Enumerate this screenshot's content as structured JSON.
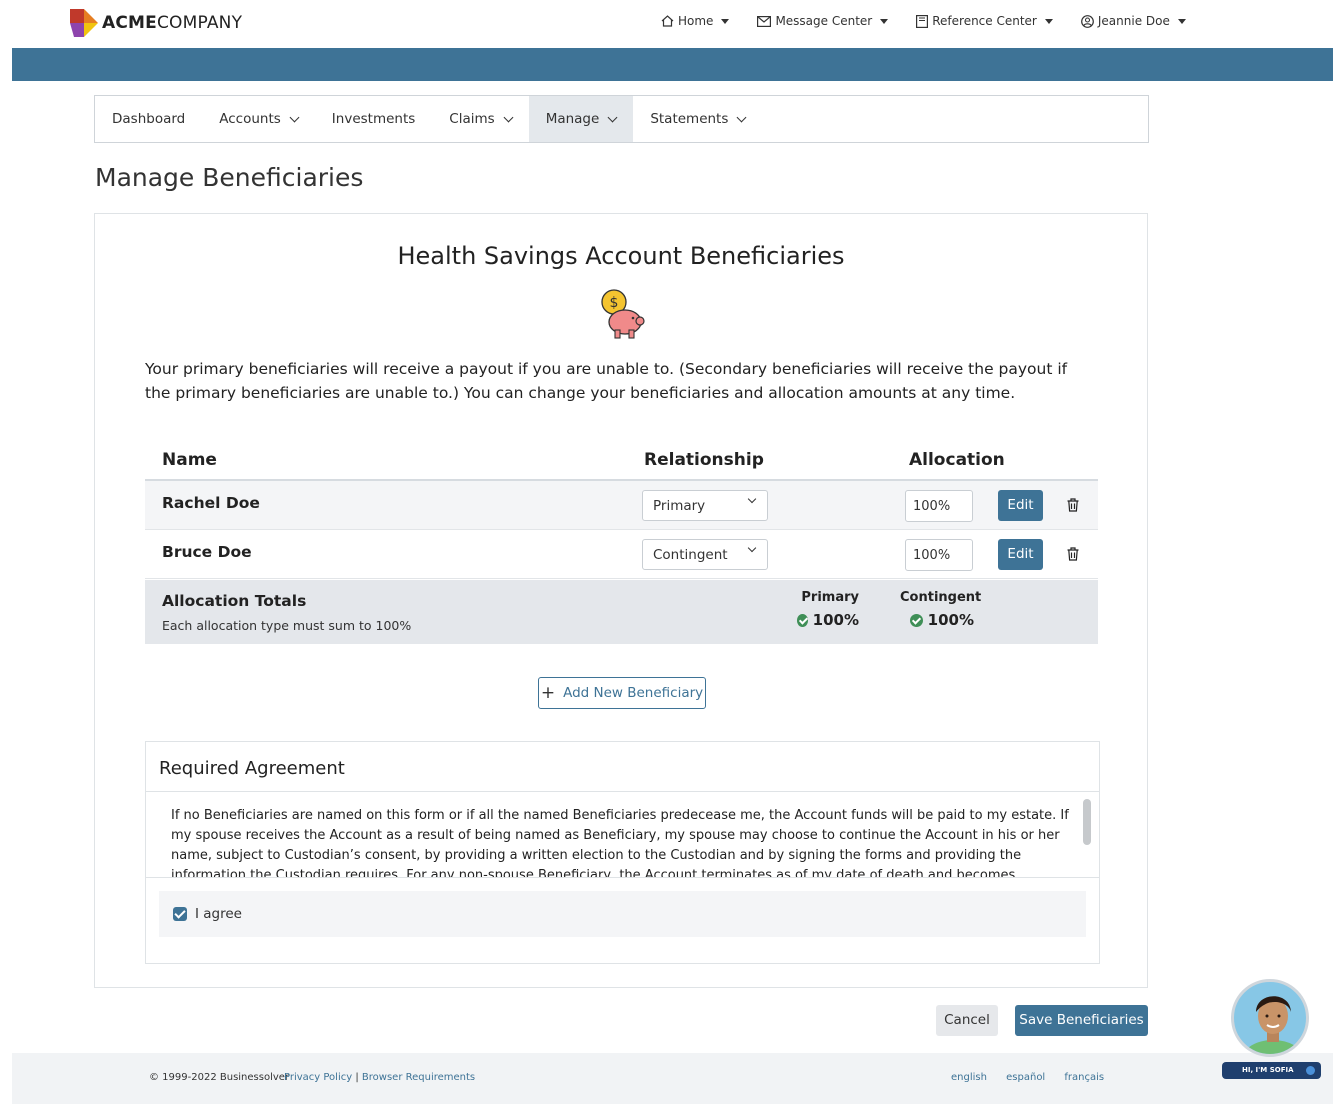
{
  "brand": {
    "bold": "ACME",
    "light": "COMPANY"
  },
  "topnav": {
    "home": "Home",
    "message_center": "Message Center",
    "reference_center": "Reference Center",
    "user": "Jeannie Doe"
  },
  "subnav": [
    {
      "label": "Dashboard"
    },
    {
      "label": "Accounts"
    },
    {
      "label": "Investments"
    },
    {
      "label": "Claims"
    },
    {
      "label": "Manage"
    },
    {
      "label": "Statements"
    }
  ],
  "page_title": "Manage Beneficiaries",
  "card": {
    "title": "Health Savings Account Beneficiaries",
    "intro": "Your primary beneficiaries will receive a payout if you are unable to. (Secondary beneficiaries will receive the payout if the primary beneficiaries are unable to.) You can change your beneficiaries and allocation amounts at any time."
  },
  "table": {
    "headers": {
      "name": "Name",
      "relationship": "Relationship",
      "allocation": "Allocation"
    },
    "rows": [
      {
        "name": "Rachel Doe",
        "relationship": "Primary",
        "allocation": "100%",
        "edit": "Edit"
      },
      {
        "name": "Bruce Doe",
        "relationship": "Contingent",
        "allocation": "100%",
        "edit": "Edit"
      }
    ]
  },
  "totals": {
    "title": "Allocation Totals",
    "subtitle": "Each allocation type must sum to 100%",
    "primary_label": "Primary",
    "primary_value": "100%",
    "contingent_label": "Contingent",
    "contingent_value": "100%"
  },
  "add_button": "Add New Beneficiary",
  "agreement": {
    "title": "Required Agreement",
    "text": "If no Beneficiaries are named on this form or if all the named Beneficiaries predecease me, the Account funds will be paid to my estate. If my spouse receives the Account as a result of being named as Beneficiary, my spouse may choose to continue the Account in his or her name, subject to Custodian’s consent, by providing a written election to the Custodian and by signing the forms and providing the information the Custodian requires. For any non-spouse Beneficiary, the Account terminates as of my date of death and becomes payable. I understand that in",
    "checkbox_label": "I agree",
    "checked": true
  },
  "actions": {
    "cancel": "Cancel",
    "save": "Save Beneficiaries"
  },
  "footer": {
    "copyright": "© 1999-2022 Businessolver",
    "privacy": "Privacy Policy",
    "separator": "|",
    "browser": "Browser Requirements",
    "languages": [
      "english",
      "español",
      "français"
    ]
  },
  "assistant": {
    "badge": "HI, I'M SOFIA"
  },
  "colors": {
    "accent": "#3e7396",
    "success": "#3f8f57",
    "footer_bg": "#f1f3f5"
  }
}
